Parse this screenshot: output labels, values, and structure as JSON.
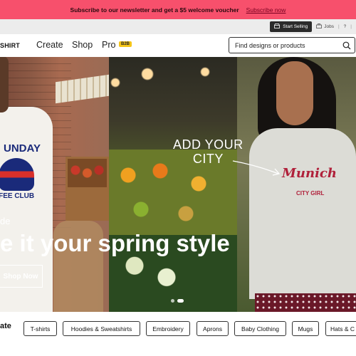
{
  "promo": {
    "message": "Subscribe to our newsletter and get a $5 welcome voucher",
    "link": "Subscribe now"
  },
  "utility": {
    "start_selling": "Start Selling",
    "jobs": "Jobs",
    "separator": "|",
    "help": "?"
  },
  "nav": {
    "logo": "SHIRT",
    "links": [
      "Create",
      "Shop",
      "Pro"
    ],
    "pro_badge": "B2B",
    "search_placeholder": "Find designs or products"
  },
  "hero": {
    "subtitle": "de",
    "title": "e it your spring style",
    "cta": "Shop Now",
    "add_city": "ADD YOUR\nCITY",
    "shirt_left_top": "UNDAY",
    "shirt_left_bottom": "FFEE CLUB",
    "shirt_right_main": "Munich",
    "shirt_right_sub": "CITY GIRL",
    "slides": 2,
    "active_slide": 2
  },
  "categories": {
    "title": "ate",
    "items": [
      "T-shirts",
      "Hoodies & Sweatshirts",
      "Embroidery",
      "Aprons",
      "Baby Clothing",
      "Mugs",
      "Hats & C"
    ]
  },
  "colors": {
    "promo_bg": "#f7506c",
    "accent_badge": "#f5c518",
    "utility_bg": "#ececec"
  }
}
